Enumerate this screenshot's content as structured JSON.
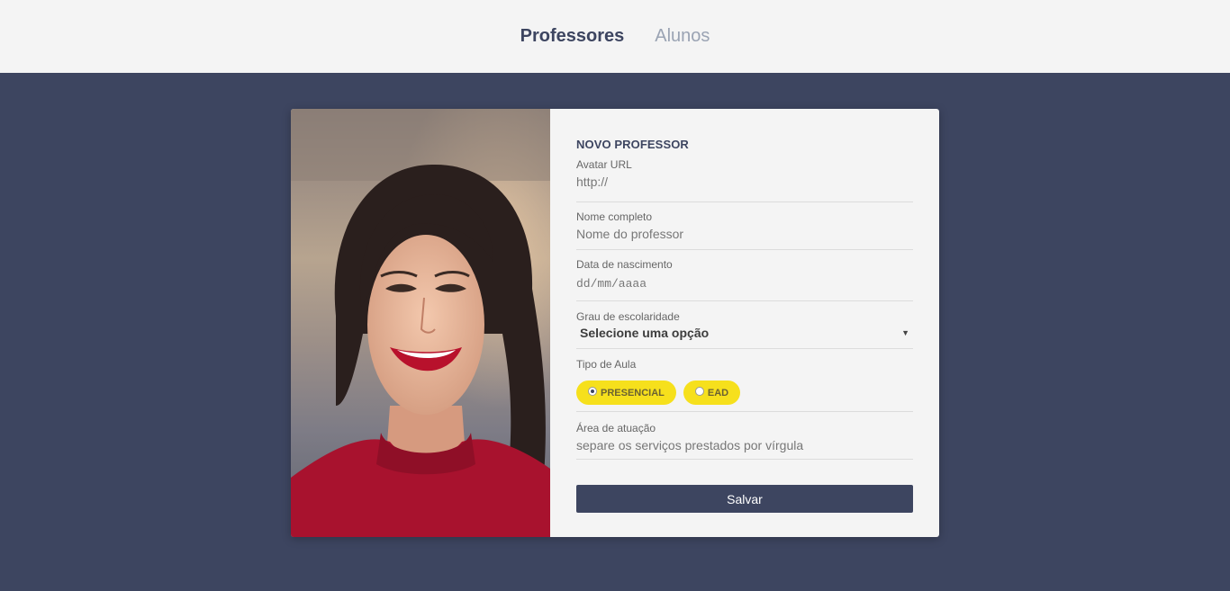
{
  "nav": {
    "items": [
      {
        "label": "Professores",
        "active": true
      },
      {
        "label": "Alunos",
        "active": false
      }
    ]
  },
  "form": {
    "title": "NOVO PROFESSOR",
    "avatar": {
      "label": "Avatar URL",
      "placeholder": "http://"
    },
    "name": {
      "label": "Nome completo",
      "placeholder": "Nome do professor"
    },
    "birthdate": {
      "label": "Data de nascimento",
      "placeholder": "dd/mm/aaaa"
    },
    "education": {
      "label": "Grau de escolaridade",
      "selected": "Selecione uma opção"
    },
    "class_type": {
      "label": "Tipo de Aula",
      "options": [
        {
          "label": "PRESENCIAL",
          "checked": true
        },
        {
          "label": "EAD",
          "checked": false
        }
      ]
    },
    "area": {
      "label": "Área de atuação",
      "placeholder": "separe os serviços prestados por vírgula"
    },
    "save_label": "Salvar"
  },
  "colors": {
    "primary": "#3d4560",
    "accent": "#f6e01c",
    "topbar_bg": "#f4f4f4",
    "nav_inactive": "#9aa3b3"
  }
}
